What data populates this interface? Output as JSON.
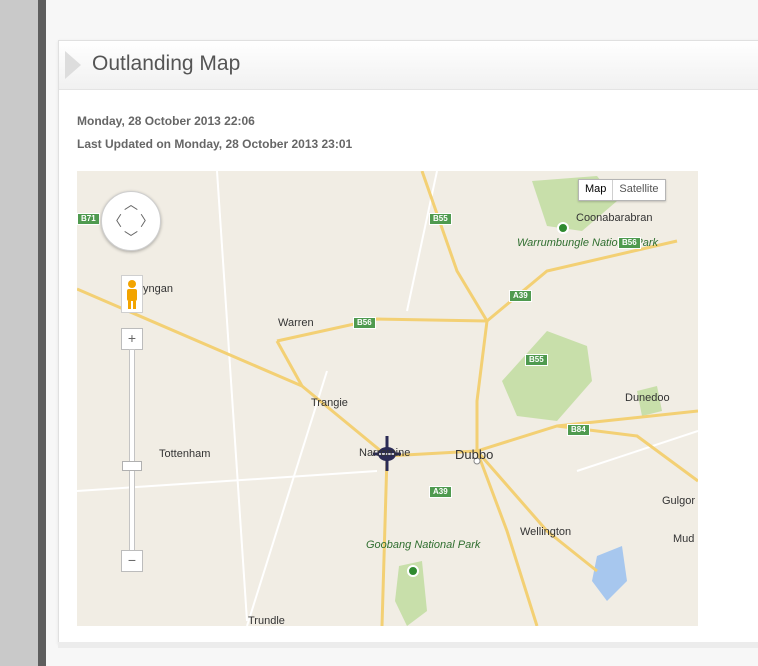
{
  "article": {
    "title": "Outlanding Map",
    "created": "Monday, 28 October 2013 22:06",
    "updated": "Last Updated on Monday, 28 October 2013 23:01"
  },
  "map": {
    "map_type": {
      "map": "Map",
      "satellite": "Satellite"
    },
    "zoom": {
      "plus": "+",
      "minus": "−"
    },
    "places": {
      "coonabarabran": "Coonabarabran",
      "warrumbungle": "Warrumbungle National Park",
      "nyngan": "yngan",
      "warren": "Warren",
      "trangie": "Trangie",
      "dunedoo": "Dunedoo",
      "tottenham": "Tottenham",
      "narromine": "Narromine",
      "dubbo": "Dubbo",
      "gulgong": "Gulgor",
      "mudgee": "Mud",
      "wellington": "Wellington",
      "goobang": "Goobang National Park",
      "trundle": "Trundle"
    },
    "shields": {
      "b71": "B71",
      "b55_top": "B55",
      "b56_right": "B56",
      "a39_top": "A39",
      "b56_mid": "B56",
      "b55_mid": "B55",
      "b84": "B84",
      "a39_bottom": "A39"
    },
    "colors": {
      "land": "#f1ede4",
      "park": "#c8dfaa",
      "highway": "#f3d074",
      "minor_road": "#ffffff",
      "water": "#a7c7ee",
      "shield": "#4f9a4f"
    }
  }
}
